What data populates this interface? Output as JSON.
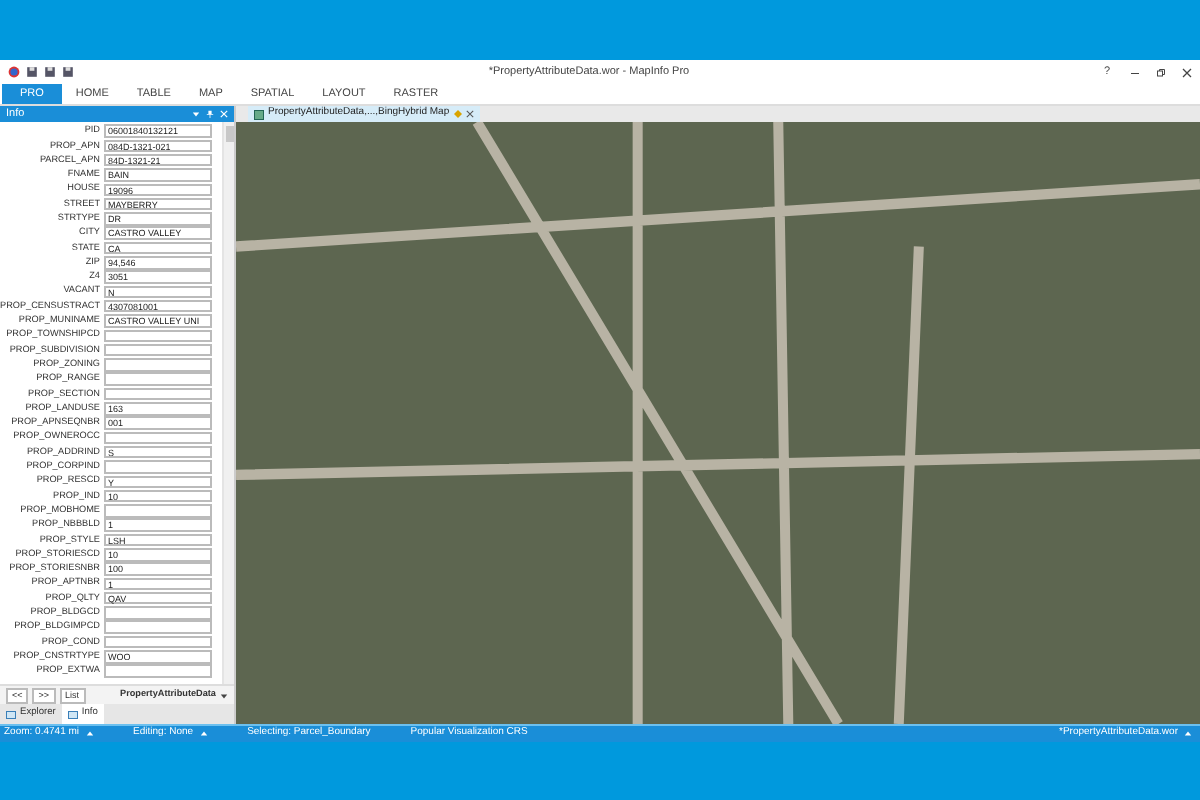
{
  "window": {
    "title": "*PropertyAttributeData.wor - MapInfo Pro",
    "controls": [
      "?"
    ]
  },
  "ribbon_tabs": [
    {
      "label": "PRO",
      "selected": true
    },
    {
      "label": "HOME",
      "selected": false
    },
    {
      "label": "TABLE",
      "selected": false
    },
    {
      "label": "MAP",
      "selected": false
    },
    {
      "label": "SPATIAL",
      "selected": false
    },
    {
      "label": "LAYOUT",
      "selected": false
    },
    {
      "label": "RASTER",
      "selected": false
    }
  ],
  "info_panel": {
    "title": "Info",
    "fields": [
      {
        "label": "PID",
        "value": "06001840132121"
      },
      {
        "label": "PROP_APN",
        "value": "084D-1321-021"
      },
      {
        "label": "PARCEL_APN",
        "value": "84D-1321-21"
      },
      {
        "label": "FNAME",
        "value": "BAIN"
      },
      {
        "label": "HOUSE",
        "value": "19096"
      },
      {
        "label": "STREET",
        "value": "MAYBERRY"
      },
      {
        "label": "STRTYPE",
        "value": "DR"
      },
      {
        "label": "CITY",
        "value": "CASTRO VALLEY"
      },
      {
        "label": "STATE",
        "value": "CA"
      },
      {
        "label": "ZIP",
        "value": "94,546"
      },
      {
        "label": "Z4",
        "value": "3051"
      },
      {
        "label": "VACANT",
        "value": "N"
      },
      {
        "label": "PROP_CENSUSTRACT",
        "value": "4307081001"
      },
      {
        "label": "PROP_MUNINAME",
        "value": "CASTRO VALLEY UNI"
      },
      {
        "label": "PROP_TOWNSHIPCD"
      },
      {
        "label": "PROP_SUBDIVISION"
      },
      {
        "label": "PROP_ZONING"
      },
      {
        "label": "PROP_RANGE"
      },
      {
        "label": "PROP_SECTION"
      },
      {
        "label": "PROP_LANDUSE",
        "value": "163"
      },
      {
        "label": "PROP_APNSEQNBR",
        "value": "001"
      },
      {
        "label": "PROP_OWNEROCC"
      },
      {
        "label": "PROP_ADDRIND",
        "value": "S"
      },
      {
        "label": "PROP_CORPIND"
      },
      {
        "label": "PROP_RESCD",
        "value": "Y"
      },
      {
        "label": "PROP_IND",
        "value": "10"
      },
      {
        "label": "PROP_MOBHOME"
      },
      {
        "label": "PROP_NBBBLD",
        "value": "1"
      },
      {
        "label": "PROP_STYLE",
        "value": "LSH"
      },
      {
        "label": "PROP_STORIESCD",
        "value": "10"
      },
      {
        "label": "PROP_STORIESNBR",
        "value": "100"
      },
      {
        "label": "PROP_APTNBR",
        "value": "1"
      },
      {
        "label": "PROP_QLTY",
        "value": "QAV"
      },
      {
        "label": "PROP_BLDGCD"
      },
      {
        "label": "PROP_BLDGIMPCD"
      },
      {
        "label": "PROP_COND"
      },
      {
        "label": "PROP_CNSTRTYPE",
        "value": "WOO"
      },
      {
        "label": "PROP_EXTWA"
      }
    ],
    "nav_buttons": [
      "<<",
      ">>",
      "List"
    ],
    "table_select": "PropertyAttributeData",
    "tabs": [
      {
        "label": "Explorer",
        "selected": false
      },
      {
        "label": "Info",
        "selected": true
      }
    ]
  },
  "map_tab": {
    "title": "PropertyAttributeData,...,BingHybrid Map"
  },
  "status_bar": [
    "Zoom: 0.4741 mi",
    "Editing: None",
    "Selecting: Parcel_Boundary",
    "Popular Visualization CRS"
  ],
  "status_right": "*PropertyAttributeData.wor"
}
